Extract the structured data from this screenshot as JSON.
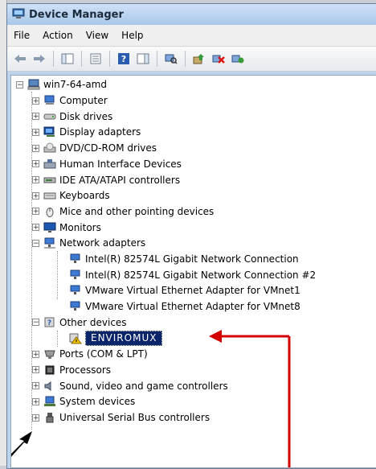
{
  "window": {
    "title": "Device Manager"
  },
  "menu": [
    "File",
    "Action",
    "View",
    "Help"
  ],
  "tree": {
    "root": "win7-64-amd",
    "items": [
      {
        "label": "Computer",
        "icon": "computer-icon",
        "expander": "+"
      },
      {
        "label": "Disk drives",
        "icon": "disk-drive-icon",
        "expander": "+"
      },
      {
        "label": "Display adapters",
        "icon": "display-adapter-icon",
        "expander": "+"
      },
      {
        "label": "DVD/CD-ROM drives",
        "icon": "dvd-drive-icon",
        "expander": "+"
      },
      {
        "label": "Human Interface Devices",
        "icon": "hid-icon",
        "expander": "+"
      },
      {
        "label": "IDE ATA/ATAPI controllers",
        "icon": "ide-controller-icon",
        "expander": "+"
      },
      {
        "label": "Keyboards",
        "icon": "keyboard-icon",
        "expander": "+"
      },
      {
        "label": "Mice and other pointing devices",
        "icon": "mouse-icon",
        "expander": "+"
      },
      {
        "label": "Monitors",
        "icon": "monitor-icon",
        "expander": "+"
      },
      {
        "label": "Network adapters",
        "icon": "network-adapter-icon",
        "expander": "-"
      },
      {
        "label": "Other devices",
        "icon": "unknown-device-icon",
        "expander": "-"
      },
      {
        "label": "Ports (COM & LPT)",
        "icon": "port-icon",
        "expander": "+"
      },
      {
        "label": "Processors",
        "icon": "processor-icon",
        "expander": "+"
      },
      {
        "label": "Sound, video and game controllers",
        "icon": "sound-icon",
        "expander": "+"
      },
      {
        "label": "System devices",
        "icon": "system-devices-icon",
        "expander": "+"
      },
      {
        "label": "Universal Serial Bus controllers",
        "icon": "usb-icon",
        "expander": "+"
      }
    ],
    "network_children": [
      "Intel(R) 82574L Gigabit Network Connection",
      "Intel(R) 82574L Gigabit Network Connection #2",
      "VMware Virtual Ethernet Adapter for VMnet1",
      "VMware Virtual Ethernet Adapter for VMnet8"
    ],
    "other_children": [
      "ENVIROMUX"
    ]
  },
  "colors": {
    "annotation_arrow": "#d40000",
    "selection": "#0a246a"
  }
}
